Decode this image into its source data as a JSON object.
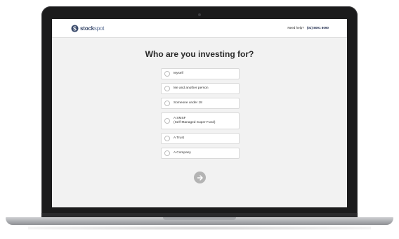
{
  "brand": {
    "name_part1": "stock",
    "name_part2": "spot"
  },
  "header": {
    "help_text": "Need help?",
    "phone": "(02) 8091 8090"
  },
  "page": {
    "title": "Who are you investing for?"
  },
  "options": [
    {
      "label": "Myself",
      "sublabel": ""
    },
    {
      "label": "Me and another person",
      "sublabel": ""
    },
    {
      "label": "Someone under 18",
      "sublabel": ""
    },
    {
      "label": "A SMSF",
      "sublabel": "(Self-Managed Super Fund)"
    },
    {
      "label": "A Trust",
      "sublabel": ""
    },
    {
      "label": "A Company",
      "sublabel": ""
    }
  ],
  "next_button": {
    "icon": "arrow-right-icon"
  },
  "colors": {
    "brand": "#3a4a6b",
    "background": "#f2f2f2",
    "button": "#b4b4b4"
  }
}
